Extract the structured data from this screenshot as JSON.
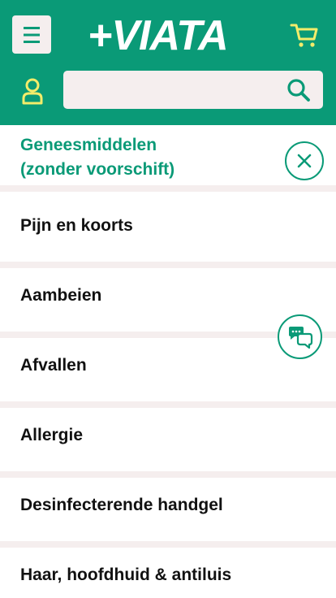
{
  "header": {
    "logo_text": "+VIATA",
    "search_placeholder": "",
    "brand_color": "#0a9a77",
    "icon_accent": "#f3ec6a"
  },
  "icons": {
    "menu": "hamburger-menu-icon",
    "cart": "shopping-cart-icon",
    "account": "user-icon",
    "search": "search-icon",
    "close": "close-icon",
    "chat": "chat-bubbles-icon"
  },
  "category": {
    "title_line1": "Geneesmiddelen",
    "title_line2": "(zonder voorschift)"
  },
  "items": [
    {
      "label": "Pijn en koorts"
    },
    {
      "label": "Aambeien"
    },
    {
      "label": "Afvallen"
    },
    {
      "label": "Allergie"
    },
    {
      "label": "Desinfecterende handgel"
    },
    {
      "label": "Haar, hoofdhuid & antiluis"
    }
  ]
}
